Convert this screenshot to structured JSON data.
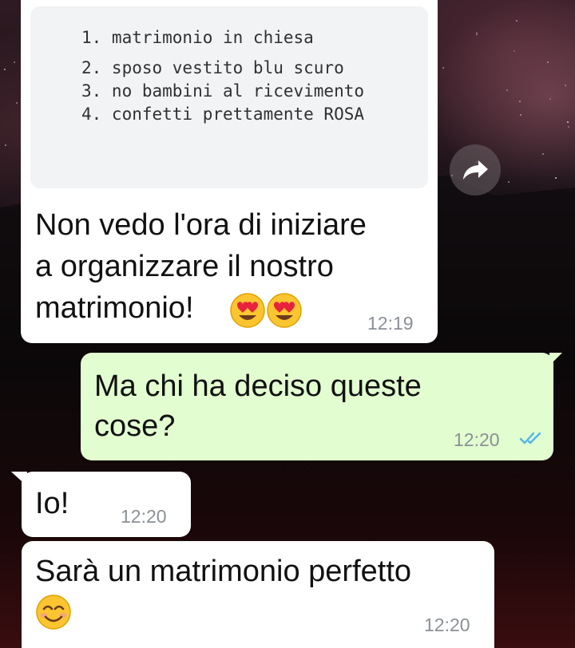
{
  "chat": {
    "msg1": {
      "list": [
        "1. matrimonio in chiesa",
        "2. sposo vestito blu scuro",
        "3. no bambini al ricevimento",
        "4. confetti prettamente ROSA"
      ],
      "lines": [
        "Non vedo l'ora di iniziare",
        "a organizzare il nostro",
        "matrimonio!"
      ],
      "emoji": "smiling-face-with-heart-eyes",
      "time": "12:19"
    },
    "msg2": {
      "lines": [
        "Ma chi ha deciso queste",
        "cose?"
      ],
      "time": "12:20",
      "status": "read"
    },
    "msg3": {
      "text": "Io!",
      "time": "12:20"
    },
    "msg4": {
      "text": "Sarà un matrimonio perfetto",
      "emoji": "smiling-face-with-smiling-eyes",
      "time": "12:20"
    }
  },
  "colors": {
    "incoming_bubble": "#ffffff",
    "outgoing_bubble": "#e2fdd0",
    "read_ticks": "#4fb6ec",
    "timestamp": "#8a9096"
  },
  "icons": {
    "forward": "forward-arrow-icon",
    "read_status": "double-check-icon"
  }
}
